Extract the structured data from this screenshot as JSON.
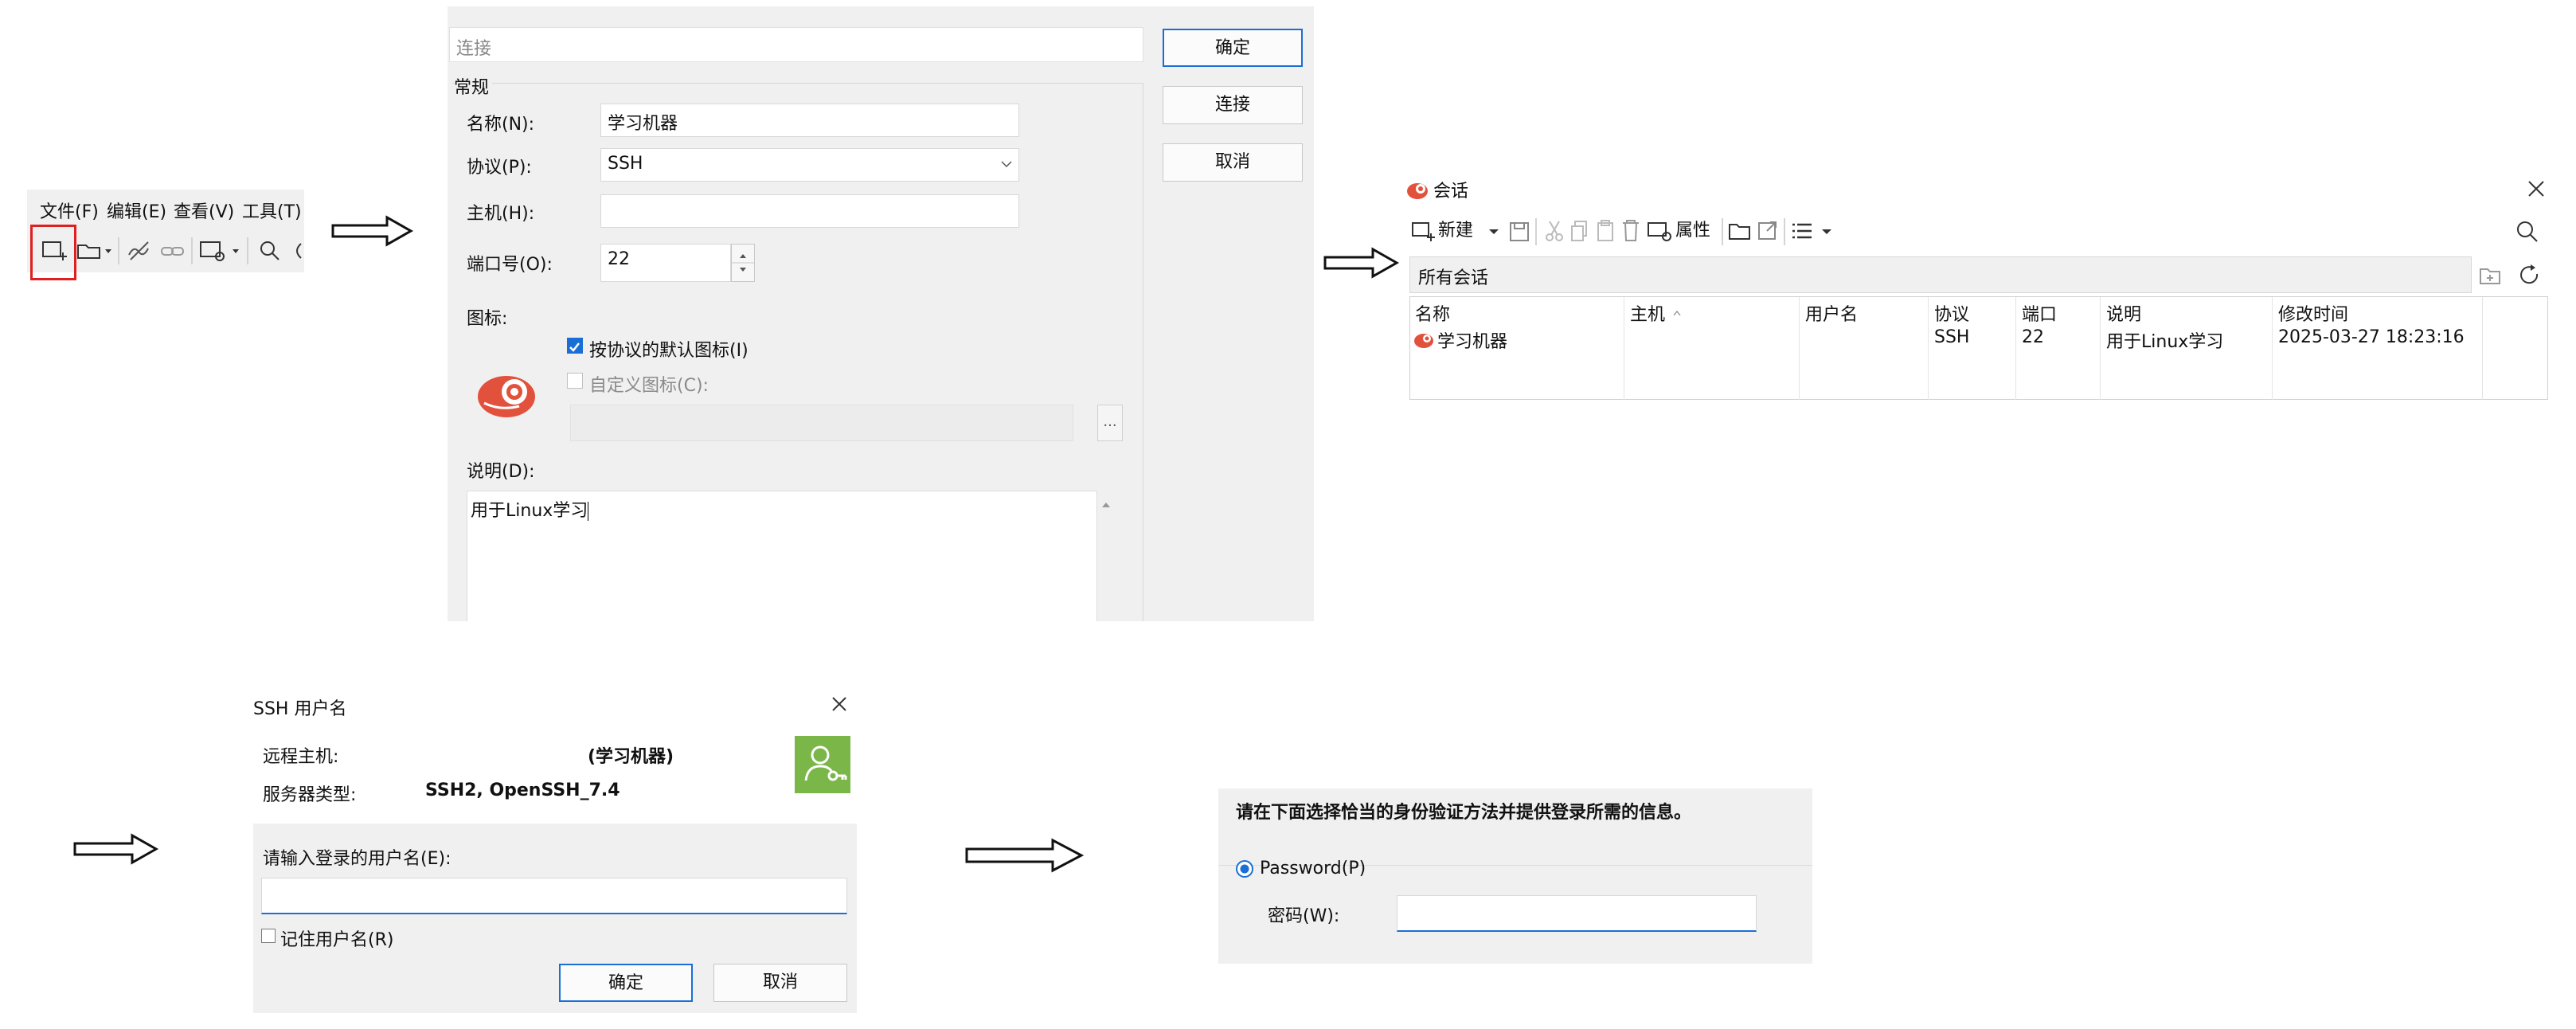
{
  "menu": {
    "items": [
      "文件(F)",
      "编辑(E)",
      "查看(V)",
      "工具(T)"
    ],
    "highlight_color": "#e02020"
  },
  "properties": {
    "tree_header": "连接",
    "section": "常规",
    "name_label": "名称(N):",
    "name_value": "学习机器",
    "protocol_label": "协议(P):",
    "protocol_value": "SSH",
    "host_label": "主机(H):",
    "host_value": "",
    "port_label": "端口号(O):",
    "port_value": "22",
    "icon_label": "图标:",
    "default_icon_label": "按协议的默认图标(I)",
    "default_icon_checked": true,
    "custom_icon_label": "自定义图标(C):",
    "custom_icon_checked": false,
    "browse_label": "...",
    "desc_label": "说明(D):",
    "desc_value": "用于Linux学习",
    "buttons": {
      "ok": "确定",
      "connect": "连接",
      "cancel": "取消"
    },
    "accent": "#1a6fd6",
    "logo_color": "#e2513c"
  },
  "sessions": {
    "title": "会话",
    "toolbar": {
      "new": "新建",
      "properties": "属性"
    },
    "path": "所有会话",
    "columns": [
      "名称",
      "主机",
      "用户名",
      "协议",
      "端口",
      "说明",
      "修改时间"
    ],
    "rows": [
      {
        "name": "学习机器",
        "host": "",
        "user": "",
        "protocol": "SSH",
        "port": "22",
        "desc": "用于Linux学习",
        "modified": "2025-03-27 18:23:16"
      }
    ]
  },
  "ssh_user": {
    "title": "SSH 用户名",
    "remote_host_label": "远程主机:",
    "remote_host_value": "(学习机器)",
    "server_type_label": "服务器类型:",
    "server_type_value": "SSH2, OpenSSH_7.4",
    "prompt": "请输入登录的用户名(E):",
    "username_value": "",
    "remember_label": "记住用户名(R)",
    "remember_checked": false,
    "buttons": {
      "ok": "确定",
      "cancel": "取消"
    },
    "badge_color": "#7ab648"
  },
  "auth": {
    "heading": "请在下面选择恰当的身份验证方法并提供登录所需的信息。",
    "method_label": "Password(P)",
    "method_selected": true,
    "password_label": "密码(W):",
    "password_value": ""
  }
}
